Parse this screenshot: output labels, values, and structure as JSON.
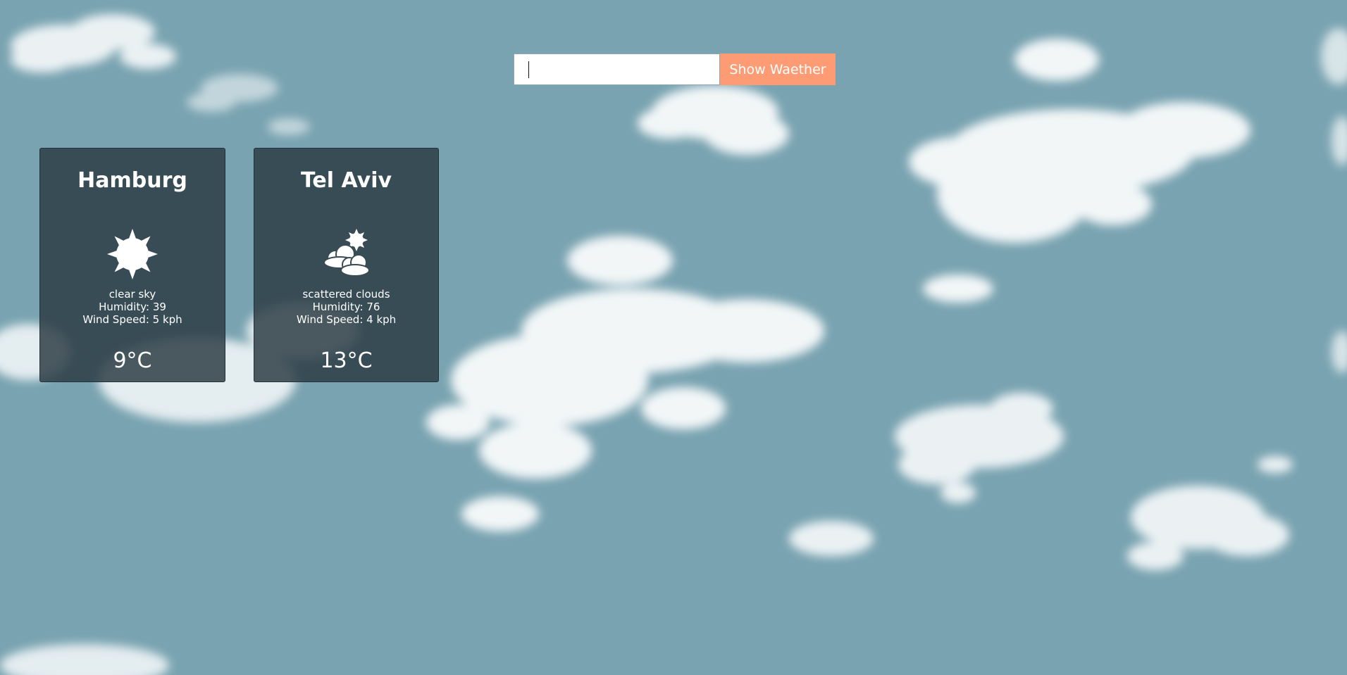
{
  "search": {
    "value": "",
    "button_label": "Show Waether"
  },
  "cards": [
    {
      "city": "Hamburg",
      "icon": "sun-icon",
      "description": "clear sky",
      "humidity": "Humidity: 39",
      "wind": "Wind Speed: 5 kph",
      "temperature": "9°C"
    },
    {
      "city": "Tel Aviv",
      "icon": "sun-behind-clouds-icon",
      "description": "scattered clouds",
      "humidity": "Humidity: 76",
      "wind": "Wind Speed: 4 kph",
      "temperature": "13°C"
    }
  ],
  "colors": {
    "sky": "#79a3b1",
    "button": "#fd9c74",
    "card": "#2c3c44",
    "text": "#ffffff"
  }
}
